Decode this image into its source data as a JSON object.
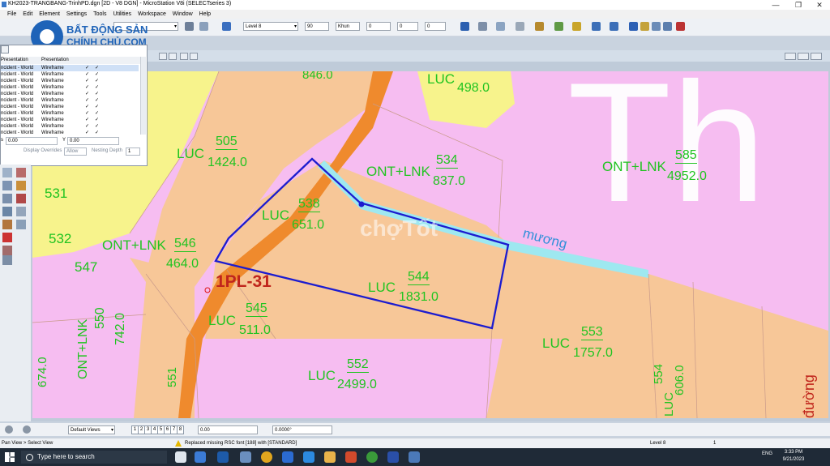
{
  "window": {
    "title": "KH2023-TRANGBANG-TrinhPD.dgn [2D - V8 DGN] - MicroStation V8i (SELECTseries 3)",
    "minimize": "—",
    "maximize": "❐",
    "close": "✕"
  },
  "menu": [
    "File",
    "Edit",
    "Element",
    "Settings",
    "Tools",
    "Utilities",
    "Workspace",
    "Window",
    "Help"
  ],
  "toolbar": {
    "level_combo": "Level 8",
    "weight_value": "90",
    "linestyle_value": "Khun",
    "linestyle_num": "0",
    "transparency_value": "0",
    "priority_value": "0"
  },
  "logo": {
    "line1": "BẤT ĐỘNG SẢN",
    "line2": "CHÍNH CHỦ.COM"
  },
  "view_panel": {
    "columns": [
      "Presentation",
      "Presentation"
    ],
    "rows": [
      {
        "a": "ncident - World",
        "b": "Wireframe"
      },
      {
        "a": "ncident - World",
        "b": "Wireframe"
      },
      {
        "a": "ncident - World",
        "b": "Wireframe"
      },
      {
        "a": "ncident - World",
        "b": "Wireframe"
      },
      {
        "a": "ncident - World",
        "b": "Wireframe"
      },
      {
        "a": "ncident - World",
        "b": "Wireframe"
      },
      {
        "a": "ncident - World",
        "b": "Wireframe"
      },
      {
        "a": "ncident - World",
        "b": "Wireframe"
      },
      {
        "a": "ncident - World",
        "b": "Wireframe"
      },
      {
        "a": "ncident - World",
        "b": "Wireframe"
      },
      {
        "a": "ncident - World",
        "b": "Wireframe"
      }
    ],
    "check": "✓",
    "x_label": "s",
    "x_value": "0.00",
    "y_label": "Y",
    "y_value": "0.00",
    "display_overrides": "Display Overrides",
    "allow": "Allow",
    "nesting_label": "Nesting Depth",
    "nesting_value": "1"
  },
  "map": {
    "parcels": [
      {
        "type": "LUC",
        "num": "498.0"
      },
      {
        "type": "",
        "num": "846.0"
      },
      {
        "type": "LUC",
        "num": "505",
        "area": "1424.0"
      },
      {
        "type": "ONT+LNK",
        "num": "534",
        "area": "837.0"
      },
      {
        "type": "ONT+LNK",
        "num": "585",
        "area": "4952.0"
      },
      {
        "type": "",
        "num": "531"
      },
      {
        "type": "LUC",
        "num": "538",
        "area": "651.0"
      },
      {
        "type": "",
        "num": "532"
      },
      {
        "type": "ONT+LNK",
        "num": "546",
        "area": "464.0"
      },
      {
        "type": "",
        "num": "547"
      },
      {
        "type": "LUC",
        "num": "544",
        "area": "1831.0"
      },
      {
        "type": "LUC",
        "num": "545",
        "area": "511.0"
      },
      {
        "type": "ONT+LNK",
        "num": "550",
        "area": "742.0"
      },
      {
        "type": "LUC",
        "num": "553",
        "area": "1757.0"
      },
      {
        "type": "LUC",
        "num": "552",
        "area": "2499.0"
      },
      {
        "type": "LUC",
        "num": "554",
        "area": "606.0"
      },
      {
        "type": "",
        "num": "674.0"
      },
      {
        "type": "",
        "num": "551"
      }
    ],
    "highlight_label": "1PL-31",
    "canal_label": "mương",
    "road_label": "đường",
    "watermark": "chợTốt",
    "small_white": "Th"
  },
  "viewbar": {
    "views_combo": "Default Views",
    "view_nums": [
      "1",
      "2",
      "3",
      "4",
      "5",
      "6",
      "7",
      "8"
    ],
    "field1": "0.00",
    "field2": "0.0000°"
  },
  "status": {
    "left": "Pan View > Select View",
    "message": "Replaced missing RSC font [188] with [STANDARD]",
    "level": "Level 8",
    "count": "1"
  },
  "taskbar": {
    "search_placeholder": "Type here to search",
    "time": "3:33 PM",
    "date": "9/21/2023",
    "lang": "ENG"
  },
  "colors": {
    "pink": "#f6bdf1",
    "orange": "#f7c798",
    "yellow": "#f7f38c",
    "road": "#ef8a2d",
    "canal": "#9ee8f0",
    "label_green": "#21c421",
    "boundary_blue": "#1c1ccf"
  }
}
